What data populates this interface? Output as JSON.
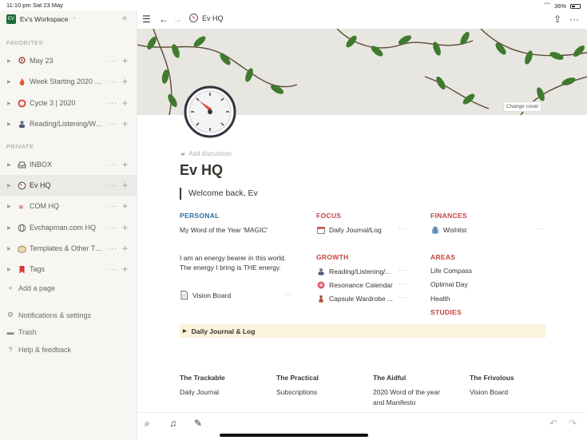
{
  "status": {
    "time": "11:10 pm",
    "date": "Sat 23 May",
    "battery": "36%"
  },
  "sidebar": {
    "workspace": "Ev's Workspace",
    "workspace_badge": "EV",
    "favorites_label": "FAVORITES",
    "private_label": "PRIVATE",
    "favorites": [
      {
        "label": "May 23",
        "icon": "pin-icon"
      },
      {
        "label": "Week Starting 2020 0...",
        "icon": "fire-icon"
      },
      {
        "label": "Cycle 3 | 2020",
        "icon": "ring-icon"
      },
      {
        "label": "Reading/Listening/Wa...",
        "icon": "person-icon"
      }
    ],
    "private": [
      {
        "label": "INBOX",
        "icon": "inbox-icon"
      },
      {
        "label": "Ev HQ",
        "icon": "gauge-icon",
        "active": true
      },
      {
        "label": "COM HQ",
        "icon": "logo-icon"
      },
      {
        "label": "Evchapman.com HQ",
        "icon": "globe-icon"
      },
      {
        "label": "Templates & Other Tin...",
        "icon": "box-icon"
      },
      {
        "label": "Tags",
        "icon": "bookmark-icon"
      }
    ],
    "add_page": "Add a page",
    "notifications": "Notifications & settings",
    "trash": "Trash",
    "help": "Help & feedback"
  },
  "topnav": {
    "breadcrumb": "Ev HQ"
  },
  "cover": {
    "change_cover": "Change cover"
  },
  "page": {
    "add_discussion": "Add discussion",
    "title": "Ev HQ",
    "quote": "Welcome back, Ev",
    "personal": {
      "heading": "PERSONAL",
      "word": "My Word of the Year 'MAGIC'",
      "line1": "I am an energy bearer in this world.",
      "line2": "The energy I bring is THE energy.",
      "vision_board": "Vision Board"
    },
    "focus": {
      "heading": "FOCUS",
      "item": "Daily Journal/Log"
    },
    "growth": {
      "heading": "GROWTH",
      "items": [
        "Reading/Listening/...",
        "Resonance Calendar",
        "Capsule Wardrobe ..."
      ]
    },
    "finances": {
      "heading": "FINANCES",
      "item": "Wishlist"
    },
    "areas": {
      "heading": "AREAS",
      "items": [
        "Life Compass",
        "Optimal Day",
        "Health"
      ]
    },
    "studies": {
      "heading": "STUDIES"
    },
    "toggle": "Daily Journal & Log",
    "columns": [
      {
        "heading": "The Trackable",
        "items": [
          "Daily Journal"
        ]
      },
      {
        "heading": "The Practical",
        "items": [
          "Subscriptions"
        ]
      },
      {
        "heading": "The Aidful",
        "items": [
          "2020 Word of the year",
          "and Manifesto"
        ]
      },
      {
        "heading": "The Frivolous",
        "items": [
          "Vision Board"
        ]
      }
    ]
  },
  "colors": {
    "personal": "#2f6f9f",
    "red_headings": "#c4443b",
    "toggle_bg": "#fbf3db",
    "sidebar_bg": "#f7f6f3"
  }
}
